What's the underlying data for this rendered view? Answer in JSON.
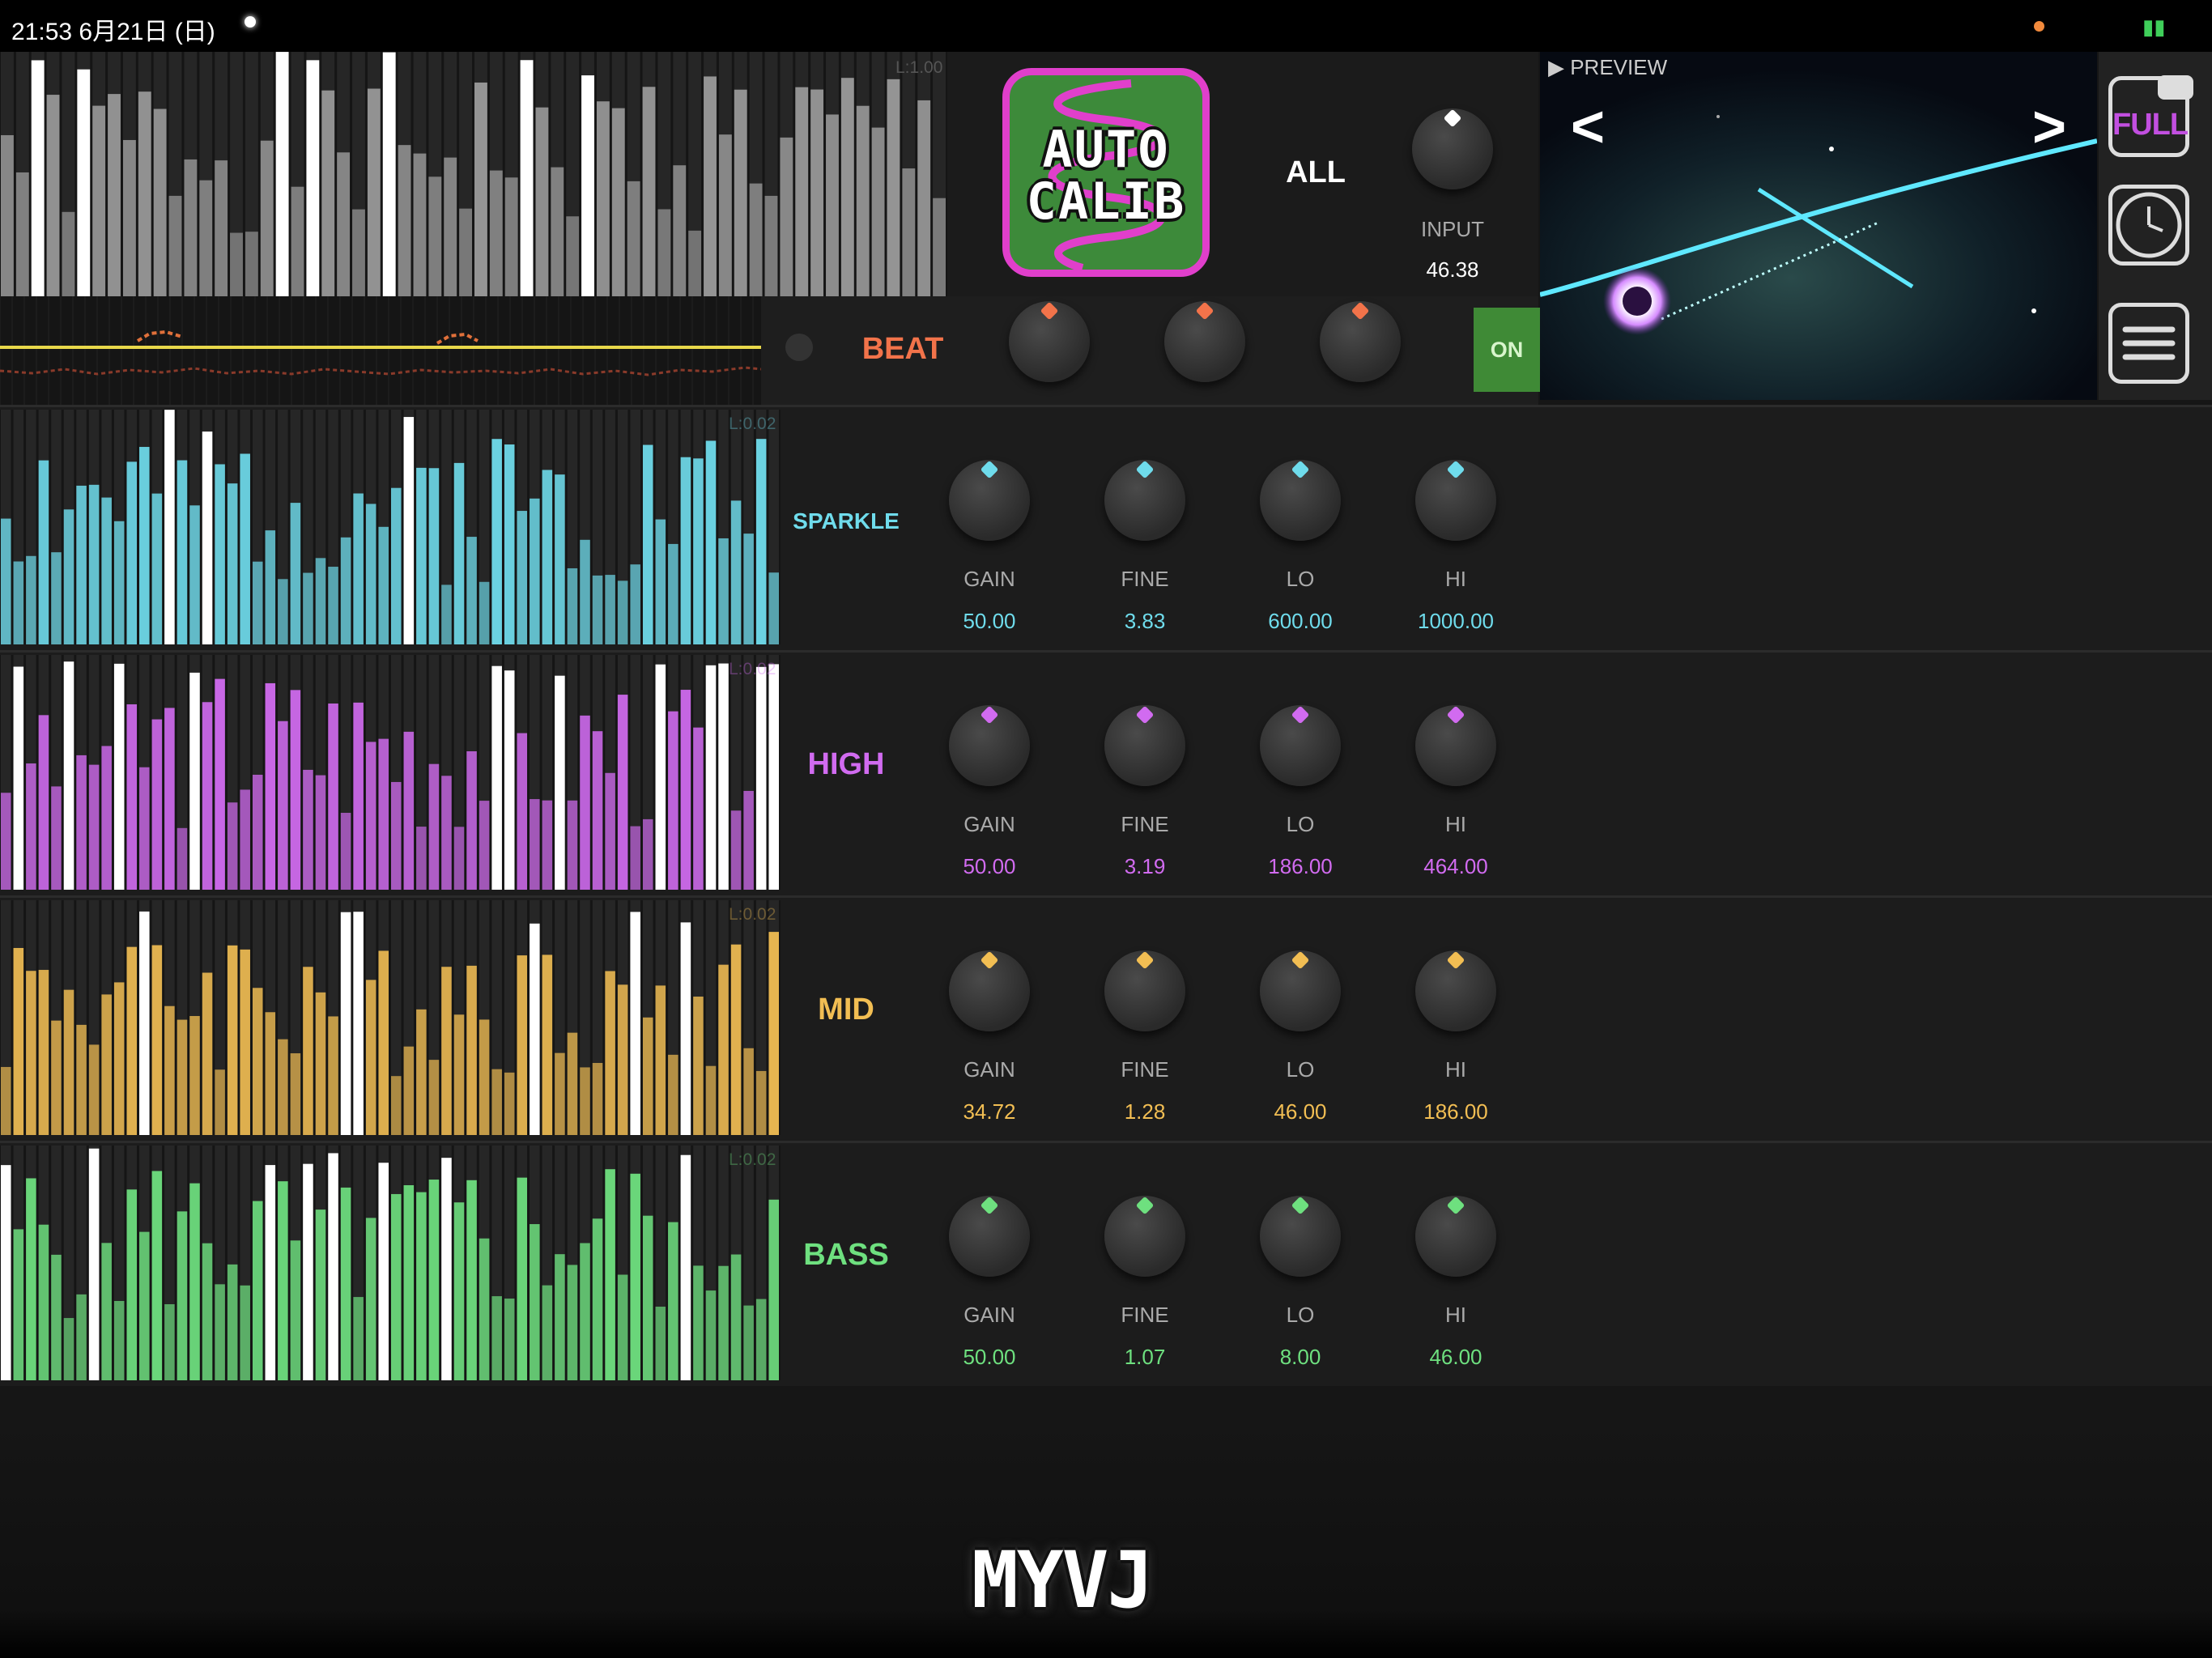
{
  "status_bar": {
    "time_date": "21:53  6月21日 (日)",
    "battery_icon": "battery-charging-icon"
  },
  "all_panel": {
    "level_label": "L:1.00",
    "autocalib": {
      "line1": "AUTO",
      "line2": "CALIB"
    },
    "title": "ALL",
    "knob_label": "INPUT",
    "knob_value": "46.38",
    "knob_color": "#ffffff"
  },
  "beat_panel": {
    "label": "BEAT",
    "color": "#f2734a",
    "on_label": "ON"
  },
  "preview": {
    "label": "PREVIEW",
    "prev": "<",
    "next": ">"
  },
  "sidebar": {
    "full_label": "FULL",
    "clock_icon": "clock-icon",
    "menu_icon": "hamburger-menu-icon"
  },
  "bands": [
    {
      "name": "SPARKLE",
      "color": "#6fdcec",
      "level_label": "L:0.02",
      "knobs": [
        {
          "label": "GAIN",
          "value": "50.00"
        },
        {
          "label": "FINE",
          "value": "3.83"
        },
        {
          "label": "LO",
          "value": "600.00"
        },
        {
          "label": "HI",
          "value": "1000.00"
        }
      ]
    },
    {
      "name": "HIGH",
      "color": "#d16bf0",
      "level_label": "L:0.02",
      "knobs": [
        {
          "label": "GAIN",
          "value": "50.00"
        },
        {
          "label": "FINE",
          "value": "3.19"
        },
        {
          "label": "LO",
          "value": "186.00"
        },
        {
          "label": "HI",
          "value": "464.00"
        }
      ]
    },
    {
      "name": "MID",
      "color": "#f2be53",
      "level_label": "L:0.02",
      "knobs": [
        {
          "label": "GAIN",
          "value": "34.72"
        },
        {
          "label": "FINE",
          "value": "1.28"
        },
        {
          "label": "LO",
          "value": "46.00"
        },
        {
          "label": "HI",
          "value": "186.00"
        }
      ]
    },
    {
      "name": "BASS",
      "color": "#6ee07f",
      "level_label": "L:0.02",
      "knobs": [
        {
          "label": "GAIN",
          "value": "50.00"
        },
        {
          "label": "FINE",
          "value": "1.07"
        },
        {
          "label": "LO",
          "value": "8.00"
        },
        {
          "label": "HI",
          "value": "46.00"
        }
      ]
    }
  ],
  "logo": "MYVJ"
}
